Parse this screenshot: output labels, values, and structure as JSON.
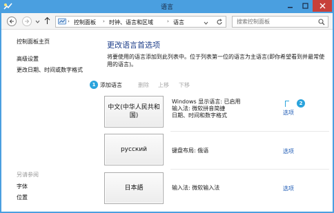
{
  "window": {
    "title": "语言",
    "colors": {
      "titlebar": "#4a9fe0",
      "close": "#c7403a",
      "link": "#1e5bb5",
      "heading": "#1e3f8a",
      "badge": "#2aa3dc"
    }
  },
  "address_bar": {
    "breadcrumbs": [
      "控制面板",
      "时钟、语言和区域",
      "语言"
    ],
    "search_placeholder": "搜索控制面板"
  },
  "sidebar": {
    "items": [
      {
        "label": "控制面板主页"
      },
      {
        "label": "高级设置"
      },
      {
        "label": "更改日期、时间或数字格式"
      }
    ],
    "see_also_title": "另请参阅",
    "see_also_items": [
      {
        "label": "字体"
      },
      {
        "label": "位置"
      }
    ]
  },
  "main": {
    "heading": "更改语言首选项",
    "description": "将要使用的语言添加到此列表中。位于列表第一位的语言为主语言(即你希望看到并最常使用的语言)。",
    "toolbar": {
      "add": "添加语言",
      "remove": "删除",
      "up": "上移",
      "down": "下移"
    },
    "badges": {
      "first": "1",
      "second": "2"
    },
    "languages": [
      {
        "name": "中文(中华人民共和国)",
        "info": [
          "Windows 显示语言: 已启用",
          "输入法: 微软拼音简捷",
          "日期、时间和数字格式"
        ],
        "options": "选项"
      },
      {
        "name": "русский",
        "info": [
          "键盘布局: 俄语"
        ],
        "options": "选项"
      },
      {
        "name": "日本語",
        "info": [
          "输入法: 微软输入法"
        ],
        "options": "选项"
      }
    ]
  }
}
